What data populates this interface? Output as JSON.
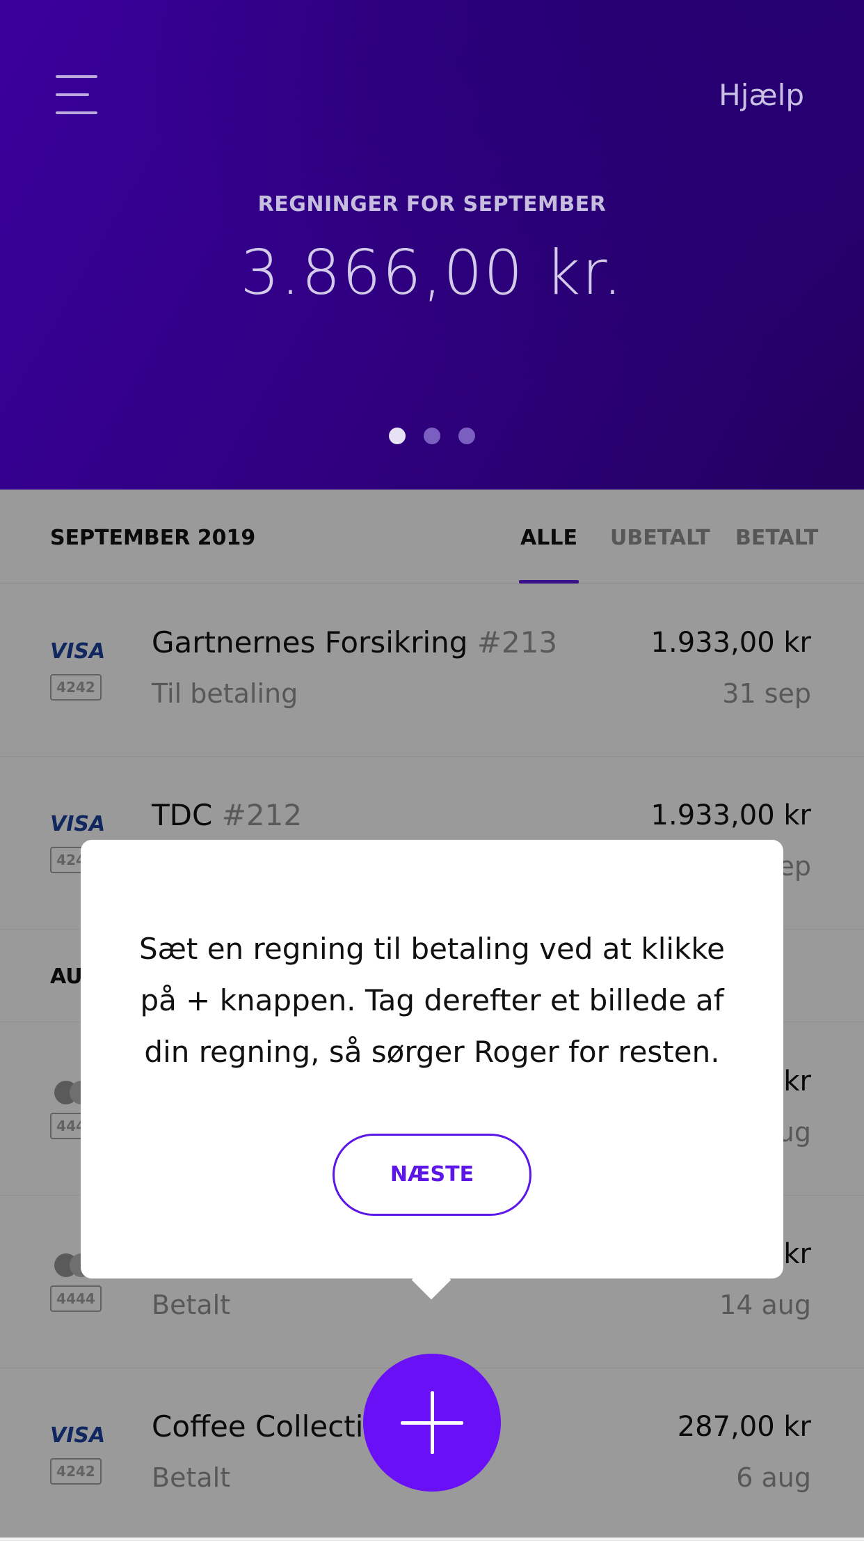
{
  "header": {
    "help_label": "Hjælp",
    "subtitle": "REGNINGER FOR SEPTEMBER",
    "amount": "3.866,00 kr.",
    "page_indicator": {
      "count": 3,
      "active": 1
    }
  },
  "tabs_bar": {
    "month_label": "SEPTEMBER 2019",
    "tabs": [
      "ALLE",
      "UBETALT",
      "BETALT"
    ],
    "active_tab": "ALLE"
  },
  "september_bills": [
    {
      "card_type": "visa",
      "card_label": "VISA",
      "card_number": "4242",
      "name": "Gartnernes Forsikring",
      "ref": "#213",
      "status": "Til betaling",
      "amount": "1.933,00 kr",
      "date": "31 sep"
    },
    {
      "card_type": "visa",
      "card_label": "VISA",
      "card_number": "4242",
      "name": "TDC",
      "ref": "#212",
      "status": "",
      "amount": "1.933,00 kr",
      "date": "ep"
    }
  ],
  "august_section": {
    "label": "AU"
  },
  "august_bills": [
    {
      "card_type": "mastercard",
      "card_number": "4444",
      "name": "",
      "ref": "",
      "status": "",
      "amount": "kr",
      "date": "ug"
    },
    {
      "card_type": "mastercard",
      "card_number": "4444",
      "name": "",
      "ref": "",
      "status": "Betalt",
      "amount": "kr",
      "date": "14 aug"
    },
    {
      "card_type": "visa",
      "card_label": "VISA",
      "card_number": "4242",
      "name": "Coffee Collecti",
      "ref": "",
      "status": "Betalt",
      "amount": "287,00 kr",
      "date": "6 aug"
    }
  ],
  "popup": {
    "message": "Sæt en regning til betaling ved at klikke på + knappen. Tag derefter et billede af din regning, så sørger Roger for resten.",
    "button_label": "NÆSTE"
  },
  "fab": {
    "icon": "plus-icon"
  },
  "colors": {
    "header": "#3a009c",
    "accent": "#5c16e8",
    "fab": "#6a10f6"
  }
}
